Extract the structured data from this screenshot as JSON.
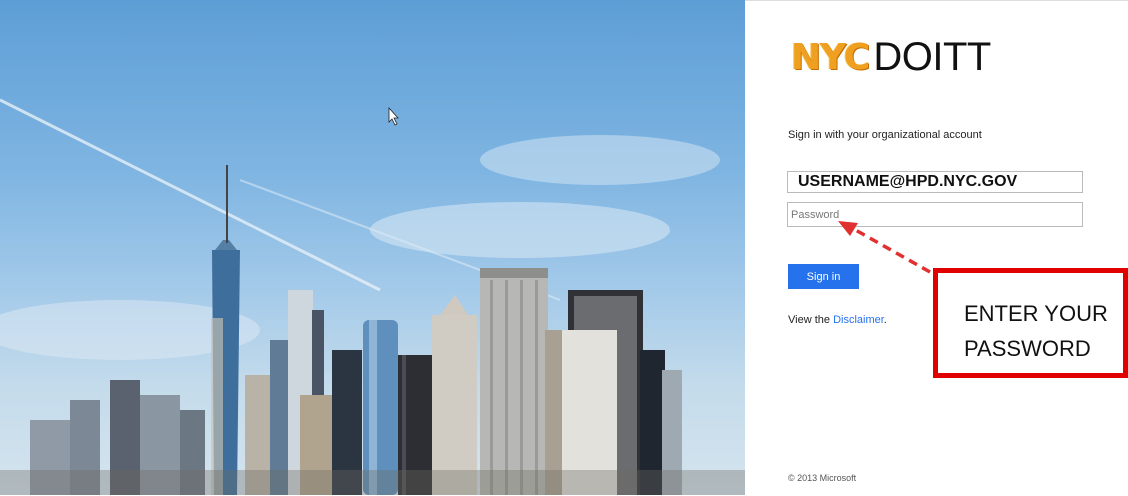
{
  "logo": {
    "nyc": "NYC",
    "doitt": "DOITT"
  },
  "prompt": "Sign in with your organizational account",
  "username": {
    "value": "USERNAME@HPD.NYC.GOV"
  },
  "password": {
    "placeholder": "Password"
  },
  "signin_label": "Sign in",
  "disclaimer": {
    "prefix": "View the ",
    "link": "Disclaimer",
    "suffix": "."
  },
  "copyright": "© 2013 Microsoft",
  "callout": {
    "line1": "ENTER YOUR",
    "line2": "PASSWORD"
  },
  "colors": {
    "button": "#2672ec",
    "link": "#2672ec",
    "callout_border": "#e00000",
    "arrow": "#e03030",
    "logo_nyc": "#f0a020"
  },
  "icons": [
    "cursor-icon",
    "arrow-annotation"
  ]
}
